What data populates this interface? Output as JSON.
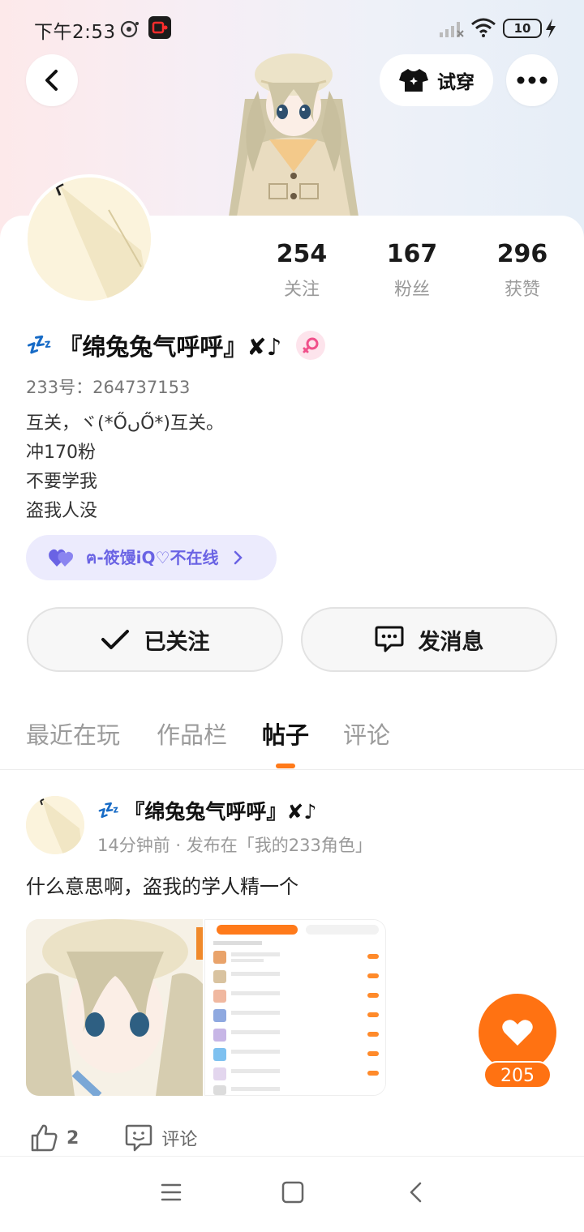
{
  "status_bar": {
    "time": "下午2:53",
    "battery": "10"
  },
  "header": {
    "try_on_label": "试穿",
    "icons": [
      "back-icon",
      "shirt-icon",
      "more-icon"
    ]
  },
  "profile": {
    "stats": [
      {
        "value": "254",
        "label": "关注"
      },
      {
        "value": "167",
        "label": "粉丝"
      },
      {
        "value": "296",
        "label": "获赞"
      }
    ],
    "sleep_emoji": "💤",
    "nickname": "『绵兔兔气呼呼』✘♪",
    "gender": "female",
    "uid": "233号：264737153",
    "bio": [
      "互关，ヾ(*ŐںŐ*)互关。",
      "冲170粉",
      "不要学我",
      "盗我人没"
    ],
    "friend_tag": "ฅ-筱馒iQ♡不在线"
  },
  "actions": {
    "followed_label": "已关注",
    "message_label": "发消息"
  },
  "tabs": [
    {
      "label": "最近在玩",
      "active": false
    },
    {
      "label": "作品栏",
      "active": false
    },
    {
      "label": "帖子",
      "active": true
    },
    {
      "label": "评论",
      "active": false
    }
  ],
  "post": {
    "author_emoji": "💤",
    "author": "『绵兔兔气呼呼』✘♪",
    "meta": "14分钟前 · 发布在「我的233角色」",
    "text": "什么意思啊，盗我的学人精一个",
    "likes": "2",
    "comment_label": "评论",
    "fab_like_count": "205"
  },
  "colors": {
    "accent": "#ff7212",
    "friend_tag_bg": "#ecebfd",
    "friend_tag_text": "#6a63e4"
  }
}
